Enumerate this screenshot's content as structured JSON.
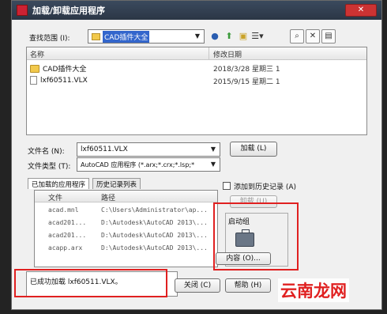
{
  "window": {
    "title": "加载/卸载应用程序",
    "close_label": "✕"
  },
  "lookin": {
    "label": "查找范围 (I):",
    "value": "CAD插件大全"
  },
  "toolbar": {
    "icons": [
      "back-icon",
      "up-folder-icon",
      "new-folder-icon",
      "views-icon"
    ],
    "right_icons": [
      "search-web-icon",
      "delete-icon",
      "views-list-icon"
    ]
  },
  "filelist": {
    "columns": {
      "name": "名称",
      "date": "修改日期"
    },
    "rows": [
      {
        "name": "CAD插件大全",
        "date": "2018/3/28 星期三 1",
        "type": "folder"
      },
      {
        "name": "lxf60511.VLX",
        "date": "2015/9/15 星期二 1",
        "type": "file"
      }
    ]
  },
  "filename": {
    "label": "文件名 (N):",
    "value": "lxf60511.VLX"
  },
  "filetype": {
    "label": "文件类型 (T):",
    "value": "AutoCAD 应用程序 (*.arx;*.crx;*.lsp;*"
  },
  "buttons": {
    "load": "加载 (L)",
    "unload": "卸载 (U)",
    "close": "关闭 (C)",
    "help": "帮助 (H)",
    "contents": "内容 (O)..."
  },
  "tabs": {
    "loaded": "已加载的应用程序",
    "history": "历史记录列表"
  },
  "add_history": {
    "label": "添加到历史记录 (A)"
  },
  "loaded_apps": {
    "columns": {
      "file": "文件",
      "path": "路径"
    },
    "rows": [
      {
        "file": "acad.mnl",
        "path": "C:\\Users\\Administrator\\ap..."
      },
      {
        "file": "acad201...",
        "path": "D:\\Autodesk\\AutoCAD 2013\\..."
      },
      {
        "file": "acad201...",
        "path": "D:\\Autodesk\\AutoCAD 2013\\..."
      },
      {
        "file": "acapp.arx",
        "path": "D:\\Autodesk\\AutoCAD 2013\\..."
      }
    ]
  },
  "startup": {
    "label": "启动组"
  },
  "status": {
    "text": "已成功加载 lxf60511.VLX。"
  },
  "watermark": {
    "text": "云南龙网"
  }
}
